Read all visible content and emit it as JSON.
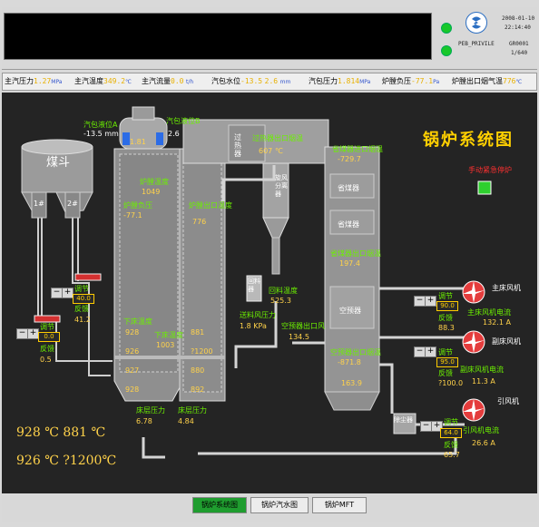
{
  "header": {
    "date": "2008-01-10",
    "time": "22:14:40",
    "user_label": "PEB_PRIVILE",
    "station": "GR0001",
    "page_count": "1/640"
  },
  "params": [
    {
      "label": "主汽压力",
      "value": "1.27",
      "unit": "MPa"
    },
    {
      "label": "主汽温度",
      "value": "349.2",
      "unit": "℃"
    },
    {
      "label": "主汽流量",
      "value": "0.0",
      "unit": "t/h"
    },
    {
      "label": "汽包水位",
      "value": "-13.5",
      "unit": "2.6",
      "unit2": "mm"
    },
    {
      "label": "汽包压力",
      "value": "1.814",
      "unit": "MPa"
    },
    {
      "label": "炉膛负压",
      "value": "-77.1",
      "unit": "Pa"
    },
    {
      "label": "炉膛出口烟气温",
      "value": "776",
      "unit": "℃"
    }
  ],
  "diagram": {
    "title": "锅炉系统图",
    "emergency_label": "手动紧急停炉",
    "coal_hopper": "煤斗",
    "feeder_1": "1#",
    "feeder_2": "2#",
    "drum_level_a_label": "汽包液位A",
    "drum_level_a_value": "-13.5",
    "drum_level_a_unit": "mm",
    "drum_level_b_label": "汽包液位B",
    "drum_level_b_value": "2.6",
    "drum_pressure": "1.81",
    "superheater": "过热器",
    "superheater_out_label": "过热器出口烟温",
    "superheater_out_value": "607",
    "superheater_out_unit": "℃",
    "economizer_in_label": "省煤器进口烟温",
    "economizer_in_value": "-729.7",
    "economizer_1": "省煤器",
    "economizer_2": "省煤器",
    "economizer_out_label": "省煤器出口烟温",
    "economizer_out_value": "197.4",
    "air_preheater": "空预器",
    "preheater_out_label": "空预器出口烟温",
    "preheater_out_value": "-871.8",
    "preheater_out_value2": "163.9",
    "cyclone": "旋风分离器",
    "cyclone_mini": "回料器",
    "furnace_temp_label": "炉膛温度",
    "furnace_temp_value": "1049",
    "furnace_pressure_label": "炉膛负压",
    "furnace_pressure_value": "-77.1",
    "furnace_out_label": "炉膛出口温度",
    "furnace_out_value": "776",
    "return_temp_label": "回料温度",
    "return_temp_value": "525.3",
    "feed_air_label": "送料风压力",
    "feed_air_value": "1.8",
    "feed_air_unit": "KPa",
    "preheater_air_label": "空预器出口风",
    "preheater_air_value": "134.5",
    "bed_temp_left_label": "下床温度",
    "bed_temps_left": [
      "928",
      "926",
      "927",
      "928"
    ],
    "bed_temp_mid_label": "下床温度",
    "bed_temp_mid": "1003",
    "bed_temps_right": [
      "881",
      "?1200",
      "880",
      "892"
    ],
    "bed_pressure_left_label": "床层压力",
    "bed_pressure_left_value": "6.78",
    "bed_pressure_right_label": "床层压力",
    "bed_pressure_right_value": "4.84",
    "feeder_left": {
      "adj_label": "调节",
      "adj_value": "0.0",
      "fb_label": "反馈",
      "fb_value": "0.5"
    },
    "feeder_1_ctrl": {
      "adj_label": "调节",
      "adj_value": "40.0",
      "fb_label": "反馈",
      "fb_value": "41.2"
    },
    "fan_primary": {
      "name": "主床风机",
      "adj_label": "调节",
      "adj_value": "90.0",
      "fb_label": "反馈",
      "fb_value": "88.3",
      "current_label": "主床风机电流",
      "current_value": "132.1",
      "current_unit": "A"
    },
    "fan_secondary": {
      "name": "副床风机",
      "adj_label": "调节",
      "adj_value": "95.0",
      "fb_label": "反馈",
      "fb_value": "?100.0",
      "current_label": "副床风机电流",
      "current_value": "11.3",
      "current_unit": "A"
    },
    "fan_induced": {
      "name": "引风机",
      "adj_label": "调节",
      "adj_value": "64.0",
      "fb_label": "反馈",
      "fb_value": "65.7",
      "current_label": "引风机电流",
      "current_value": "26.6",
      "current_unit": "A"
    },
    "dust_collector": "除尘器",
    "big_readings": {
      "r1a": "928",
      "r1b": "881",
      "r2a": "926",
      "r2b": "?1200",
      "unit": "℃"
    }
  },
  "nav": {
    "tabs": [
      "锅炉系统图",
      "锅炉汽水图",
      "锅炉MFT"
    ]
  },
  "colors": {
    "canvas_bg": "#242424",
    "value_green": "#6cf000",
    "value_yellow": "#ffd24a",
    "alarm_red": "#ff3030",
    "active_tab": "#1f9d2f"
  }
}
